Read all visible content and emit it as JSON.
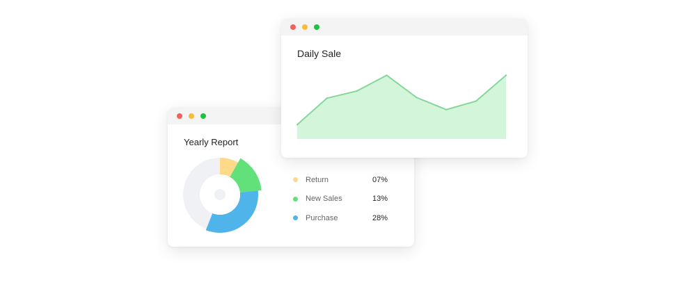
{
  "colors": {
    "dot_red": "#f4605a",
    "dot_yellow": "#f6bc3c",
    "dot_green": "#1fc247",
    "return": "#fdd98a",
    "new_sales": "#62e07a",
    "purchase": "#4fb4ea",
    "donut_track": "#f0f1f4",
    "area_fill": "#d3f5da",
    "area_line": "#86d699"
  },
  "yearly_report": {
    "title": "Yearly Report",
    "legend": [
      {
        "label": "Return",
        "value": "07%",
        "color_key": "return"
      },
      {
        "label": "New Sales",
        "value": "13%",
        "color_key": "new_sales"
      },
      {
        "label": "Purchase",
        "value": "28%",
        "color_key": "purchase"
      }
    ]
  },
  "daily_sale": {
    "title": "Daily Sale"
  },
  "chart_data": [
    {
      "type": "pie",
      "labels": [
        "Return",
        "New Sales",
        "Purchase"
      ],
      "values": [
        7,
        13,
        28
      ]
    },
    {
      "type": "area",
      "x": [
        1,
        2,
        3,
        4,
        5,
        6,
        7,
        8
      ],
      "values": [
        20,
        57,
        67,
        89,
        58,
        41,
        53,
        89
      ],
      "ylim": [
        0,
        100
      ],
      "grid": false
    }
  ]
}
